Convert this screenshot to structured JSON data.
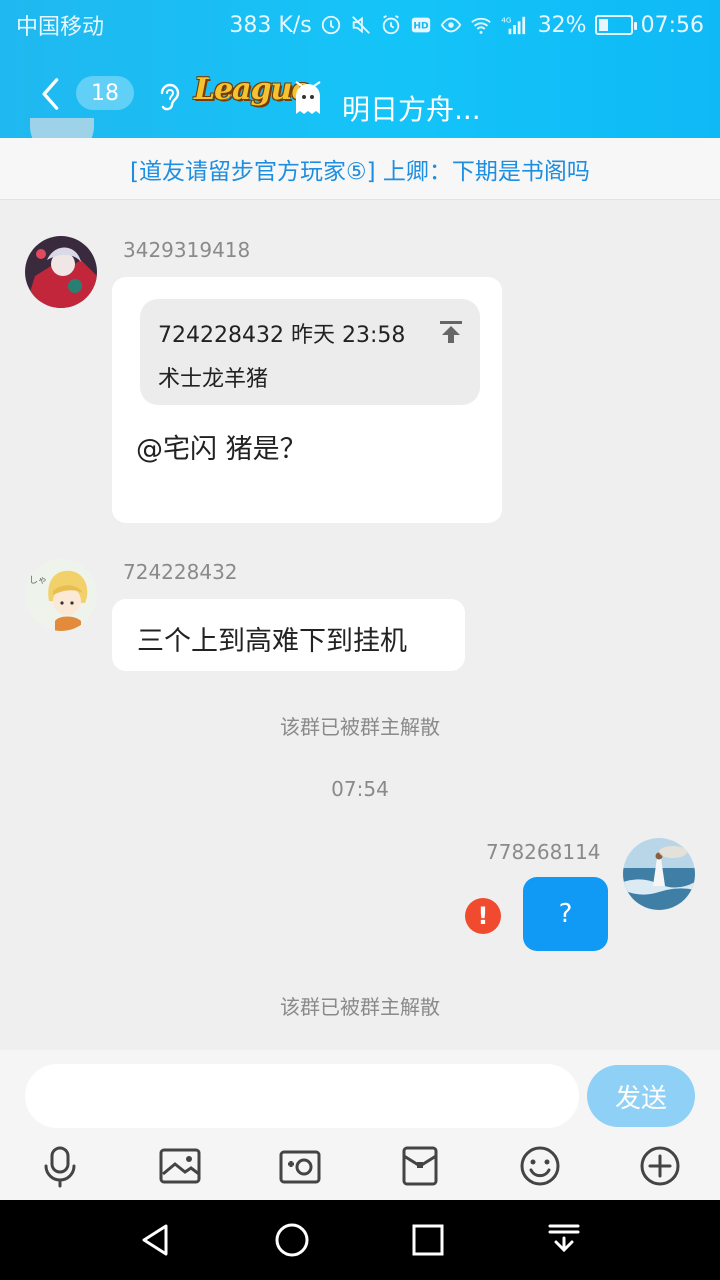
{
  "status_bar": {
    "carrier": "中国移动",
    "speed": "383 K/s",
    "network": "4G",
    "battery": "32%",
    "battery_level": 0.32,
    "time": "07:56"
  },
  "header": {
    "unread_count": "18",
    "chat_title": "明日方舟..."
  },
  "announcement": "[道友请留步官方玩家⑤] 上卿：下期是书阁吗",
  "messages": [
    {
      "sender": "3429319418",
      "quote": {
        "header": "724228432 昨天 23:58",
        "body": "术士龙羊猪"
      },
      "text": "@宅闪 猪是？"
    },
    {
      "sender": "724228432",
      "text": "三个上到高难下到挂机"
    }
  ],
  "system_notes": {
    "first": "该群已被群主解散",
    "time": "07:54",
    "second": "该群已被群主解散"
  },
  "my_message": {
    "sender": "778268114",
    "text": "?",
    "error_mark": "!"
  },
  "input": {
    "value": "",
    "send_label": "发送"
  },
  "toolbar_icons": [
    "microphone-icon",
    "picture-icon",
    "camera-icon",
    "red-packet-icon",
    "emoji-icon",
    "plus-icon"
  ],
  "colors": {
    "header_blue": "#14c4f8",
    "link_blue": "#1e8ee0",
    "my_bubble_blue": "#119af5",
    "send_button": "#8fd0f7",
    "error_red": "#f04a2f"
  }
}
